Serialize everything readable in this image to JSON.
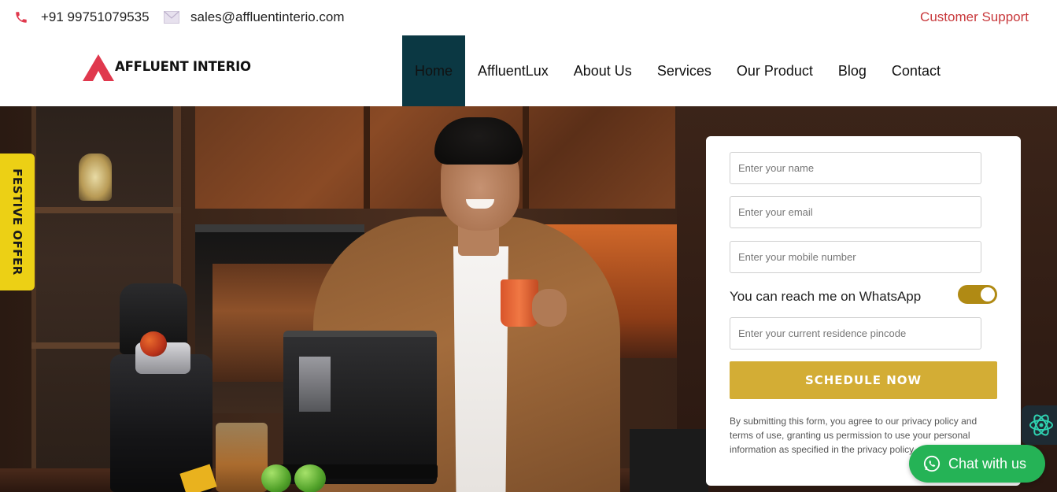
{
  "topbar": {
    "phone": "+91 99751079535",
    "email": "sales@affluentinterio.com",
    "support": "Customer Support",
    "icons": {
      "phone": "phone-icon",
      "email": "mail-icon"
    }
  },
  "header": {
    "logo_text": "AFFLUENT INTERIO",
    "nav": [
      {
        "label": "Home",
        "active": true
      },
      {
        "label": "AffluentLux"
      },
      {
        "label": "About Us"
      },
      {
        "label": "Services"
      },
      {
        "label": "Our Product"
      },
      {
        "label": "Blog"
      },
      {
        "label": "Contact"
      }
    ]
  },
  "festive_tab": "FESTIVE OFFER",
  "form": {
    "name_placeholder": "Enter your name",
    "email_placeholder": "Enter your email",
    "mobile_placeholder": "Enter your mobile number",
    "whatsapp_label": "You can reach me on WhatsApp",
    "whatsapp_enabled": true,
    "pincode_placeholder": "Enter your current residence pincode",
    "submit_label": "SCHEDULE NOW",
    "disclaimer": "By submitting this form, you agree to our privacy policy and terms of use, granting us permission to use your personal information as specified in the privacy policy."
  },
  "chat": {
    "label": "Chat with us",
    "icon": "whatsapp-icon"
  },
  "colors": {
    "brand_red": "#e0384d",
    "nav_active": "#0b3843",
    "button_gold": "#d3ad35",
    "festive_yellow": "#ecd015",
    "chat_green": "#25b356",
    "support_red": "#c8383b"
  }
}
